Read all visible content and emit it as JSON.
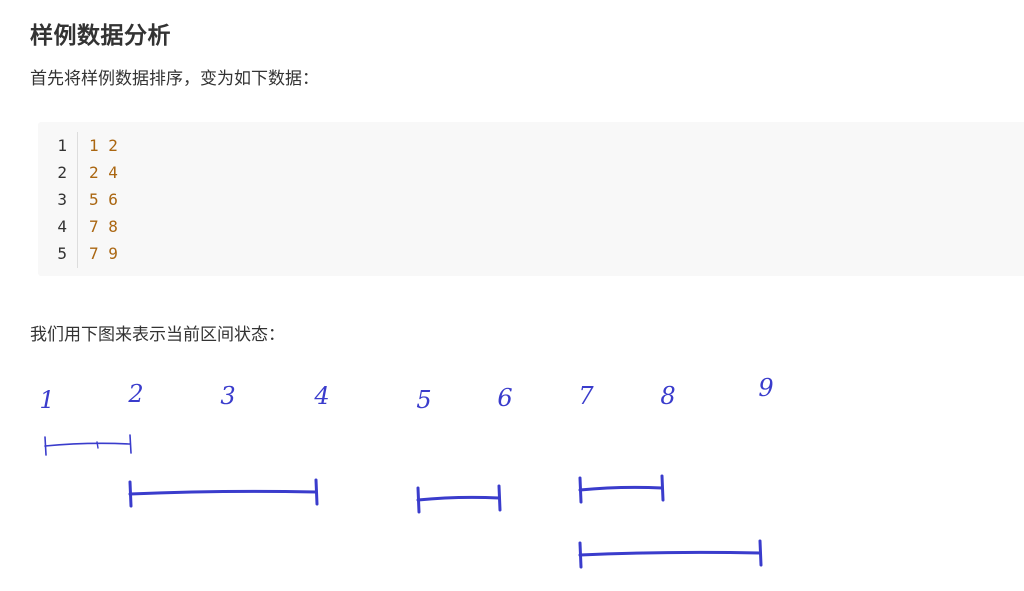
{
  "heading": "样例数据分析",
  "intro": "首先将样例数据排序，变为如下数据：",
  "code": {
    "line_numbers": [
      "1",
      "2",
      "3",
      "4",
      "5"
    ],
    "lines": [
      "1 2",
      "2 4",
      "5 6",
      "7 8",
      "7 9"
    ]
  },
  "caption": "我们用下图来表示当前区间状态：",
  "sketch": {
    "axis_labels": [
      "1",
      "2",
      "3",
      "4",
      "5",
      "6",
      "7",
      "8",
      "9"
    ],
    "intervals": [
      {
        "start": 1,
        "end": 2
      },
      {
        "start": 2,
        "end": 4
      },
      {
        "start": 5,
        "end": 6
      },
      {
        "start": 7,
        "end": 8
      },
      {
        "start": 7,
        "end": 9
      }
    ],
    "ink_color": "#3a3ccc"
  }
}
